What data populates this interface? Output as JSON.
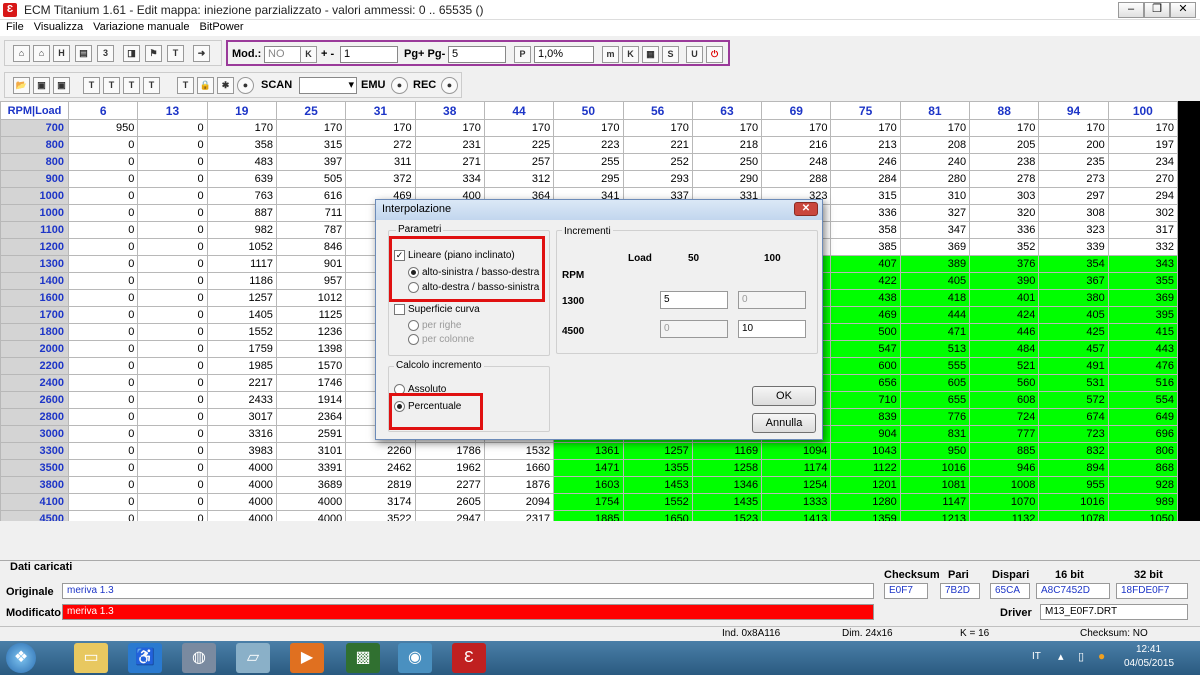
{
  "window": {
    "title": "ECM Titanium 1.61 - Edit mappa: iniezione parzializzato - valori ammessi: 0 .. 65535 ()",
    "minimize": "‒",
    "maximize": "❐",
    "close": "✕"
  },
  "menu": [
    "File",
    "Visualizza",
    "Variazione manuale",
    "BitPower"
  ],
  "toolbar": {
    "mod_label": "Mod.:",
    "mod_value": "NO",
    "k_label": "K",
    "plusminus": "+ -",
    "step_value": "1",
    "pg_label": "Pg+ Pg-",
    "pg_value": "5",
    "p_label": "P",
    "percent_value": "1,0%",
    "scan_label": "SCAN",
    "emu_label": "EMU",
    "rec_label": "REC"
  },
  "map": {
    "corner": "RPM|Load",
    "columns": [
      "6",
      "13",
      "19",
      "25",
      "31",
      "38",
      "44",
      "50",
      "56",
      "63",
      "69",
      "75",
      "81",
      "88",
      "94",
      "100"
    ],
    "rows": [
      {
        "rpm": "700",
        "values": [
          "950",
          "0",
          "170",
          "170",
          "170",
          "170",
          "170",
          "170",
          "170",
          "170",
          "170",
          "170",
          "170",
          "170",
          "170",
          "170"
        ]
      },
      {
        "rpm": "800",
        "values": [
          "0",
          "0",
          "358",
          "315",
          "272",
          "231",
          "225",
          "223",
          "221",
          "218",
          "216",
          "213",
          "208",
          "205",
          "200",
          "197"
        ]
      },
      {
        "rpm": "800",
        "values": [
          "0",
          "0",
          "483",
          "397",
          "311",
          "271",
          "257",
          "255",
          "252",
          "250",
          "248",
          "246",
          "240",
          "238",
          "235",
          "234"
        ]
      },
      {
        "rpm": "900",
        "values": [
          "0",
          "0",
          "639",
          "505",
          "372",
          "334",
          "312",
          "295",
          "293",
          "290",
          "288",
          "284",
          "280",
          "278",
          "273",
          "270"
        ]
      },
      {
        "rpm": "1000",
        "values": [
          "0",
          "0",
          "763",
          "616",
          "469",
          "400",
          "364",
          "341",
          "337",
          "331",
          "323",
          "315",
          "310",
          "303",
          "297",
          "294"
        ]
      },
      {
        "rpm": "1000",
        "values": [
          "0",
          "0",
          "887",
          "711",
          "",
          "",
          "",
          "",
          "",
          "",
          "",
          "336",
          "327",
          "320",
          "308",
          "302"
        ]
      },
      {
        "rpm": "1100",
        "values": [
          "0",
          "0",
          "982",
          "787",
          "",
          "",
          "",
          "",
          "",
          "",
          "",
          "358",
          "347",
          "336",
          "323",
          "317"
        ]
      },
      {
        "rpm": "1200",
        "values": [
          "0",
          "0",
          "1052",
          "846",
          "",
          "",
          "",
          "",
          "",
          "",
          "",
          "385",
          "369",
          "352",
          "339",
          "332"
        ]
      },
      {
        "rpm": "1300",
        "values": [
          "0",
          "0",
          "1117",
          "901",
          "",
          "",
          "",
          "",
          "",
          "",
          "",
          "407",
          "389",
          "376",
          "354",
          "343"
        ]
      },
      {
        "rpm": "1400",
        "values": [
          "0",
          "0",
          "1186",
          "957",
          "",
          "",
          "",
          "",
          "",
          "",
          "",
          "422",
          "405",
          "390",
          "367",
          "355"
        ]
      },
      {
        "rpm": "1600",
        "values": [
          "0",
          "0",
          "1257",
          "1012",
          "",
          "",
          "",
          "",
          "",
          "",
          "",
          "438",
          "418",
          "401",
          "380",
          "369"
        ]
      },
      {
        "rpm": "1700",
        "values": [
          "0",
          "0",
          "1405",
          "1125",
          "",
          "",
          "",
          "",
          "",
          "",
          "",
          "469",
          "444",
          "424",
          "405",
          "395"
        ]
      },
      {
        "rpm": "1800",
        "values": [
          "0",
          "0",
          "1552",
          "1236",
          "",
          "",
          "",
          "",
          "",
          "",
          "",
          "500",
          "471",
          "446",
          "425",
          "415"
        ]
      },
      {
        "rpm": "2000",
        "values": [
          "0",
          "0",
          "1759",
          "1398",
          "",
          "",
          "",
          "",
          "",
          "",
          "",
          "547",
          "513",
          "484",
          "457",
          "443"
        ]
      },
      {
        "rpm": "2200",
        "values": [
          "0",
          "0",
          "1985",
          "1570",
          "",
          "",
          "",
          "",
          "",
          "",
          "",
          "600",
          "555",
          "521",
          "491",
          "476"
        ]
      },
      {
        "rpm": "2400",
        "values": [
          "0",
          "0",
          "2217",
          "1746",
          "",
          "",
          "",
          "",
          "",
          "",
          "",
          "656",
          "605",
          "560",
          "531",
          "516"
        ]
      },
      {
        "rpm": "2600",
        "values": [
          "0",
          "0",
          "2433",
          "1914",
          "",
          "",
          "",
          "",
          "",
          "",
          "",
          "710",
          "655",
          "608",
          "572",
          "554"
        ]
      },
      {
        "rpm": "2800",
        "values": [
          "0",
          "0",
          "3017",
          "2364",
          "",
          "",
          "",
          "",
          "",
          "",
          "",
          "839",
          "776",
          "724",
          "674",
          "649"
        ]
      },
      {
        "rpm": "3000",
        "values": [
          "0",
          "0",
          "3316",
          "2591",
          "",
          "",
          "",
          "",
          "",
          "",
          "",
          "904",
          "831",
          "777",
          "723",
          "696"
        ]
      },
      {
        "rpm": "3300",
        "values": [
          "0",
          "0",
          "3983",
          "3101",
          "2260",
          "1786",
          "1532",
          "1361",
          "1257",
          "1169",
          "1094",
          "1043",
          "950",
          "885",
          "832",
          "806"
        ]
      },
      {
        "rpm": "3500",
        "values": [
          "0",
          "0",
          "4000",
          "3391",
          "2462",
          "1962",
          "1660",
          "1471",
          "1355",
          "1258",
          "1174",
          "1122",
          "1016",
          "946",
          "894",
          "868"
        ]
      },
      {
        "rpm": "3800",
        "values": [
          "0",
          "0",
          "4000",
          "3689",
          "2819",
          "2277",
          "1876",
          "1603",
          "1453",
          "1346",
          "1254",
          "1201",
          "1081",
          "1008",
          "955",
          "928"
        ]
      },
      {
        "rpm": "4100",
        "values": [
          "0",
          "0",
          "4000",
          "4000",
          "3174",
          "2605",
          "2094",
          "1754",
          "1552",
          "1435",
          "1333",
          "1280",
          "1147",
          "1070",
          "1016",
          "989"
        ]
      },
      {
        "rpm": "4500",
        "values": [
          "0",
          "0",
          "4000",
          "4000",
          "3522",
          "2947",
          "2317",
          "1885",
          "1650",
          "1523",
          "1413",
          "1359",
          "1213",
          "1132",
          "1078",
          "1050"
        ]
      }
    ],
    "green_from_row": 8,
    "green_from_col": 7
  },
  "info": {
    "dati_caricati": "Dati caricati",
    "originale_label": "Originale",
    "originale_value": "meriva 1.3",
    "modificato_label": "Modificato",
    "modificato_value": "meriva 1.3",
    "checksum_label": "Checksum",
    "checksum_value": "E0F7",
    "pari_label": "Pari",
    "pari_value": "7B2D",
    "dispari_label": "Dispari",
    "dispari_value": "65CA",
    "bit16_label": "16 bit",
    "bit16_value": "A8C7452D",
    "bit32_label": "32 bit",
    "bit32_value": "18FDE0F7",
    "driver_label": "Driver",
    "driver_value": "M13_E0F7.DRT"
  },
  "statusbar": {
    "ind": "Ind. 0x8A116",
    "dim": "Dim. 24x16",
    "k": "K = 16",
    "checksum": "Checksum: NO"
  },
  "taskbar": {
    "lang": "IT",
    "time": "12:41",
    "date": "04/05/2015"
  },
  "dialog": {
    "title": "Interpolazione",
    "close": "✕",
    "parametri": "Parametri",
    "lineare": "Lineare (piano inclinato)",
    "alto_sx": "alto-sinistra / basso-destra",
    "alto_dx": "alto-destra / basso-sinistra",
    "superficie": "Superficie curva",
    "per_righe": "per righe",
    "per_colonne": "per colonne",
    "calcolo": "Calcolo incremento",
    "assoluto": "Assoluto",
    "percentuale": "Percentuale",
    "incrementi": "Incrementi",
    "load_label": "Load",
    "load_1": "50",
    "load_2": "100",
    "rpm_label": "RPM",
    "rpm_1": "1300",
    "rpm_2": "4500",
    "v11": "5",
    "v12": "0",
    "v21": "0",
    "v22": "10",
    "ok": "OK",
    "annulla": "Annulla"
  },
  "colors": {
    "accent_green": "#00ff00",
    "highlight_red": "#e01010",
    "header_blue": "#1d35c7"
  }
}
